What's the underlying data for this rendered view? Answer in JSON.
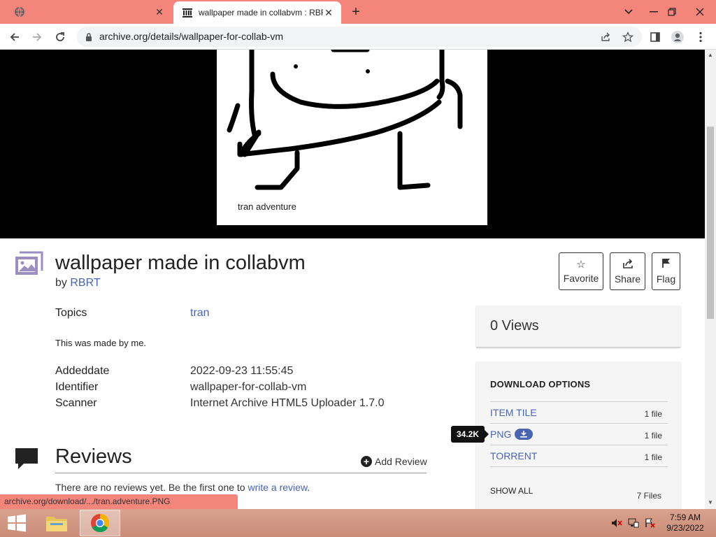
{
  "browser": {
    "tabs": [
      {
        "title": "",
        "active": false
      },
      {
        "title": "wallpaper made in collabvm : RBRT",
        "active": true
      }
    ],
    "new_tab_symbol": "+",
    "address": "archive.org/details/wallpaper-for-collab-vm",
    "status_url": "archive.org/download/.../tran.adventure.PNG"
  },
  "artwork": {
    "caption": "tran adventure"
  },
  "item": {
    "title": "wallpaper made in collabvm",
    "by_prefix": "by",
    "author": "RBRT",
    "actions": {
      "favorite": "Favorite",
      "share": "Share",
      "flag": "Flag"
    },
    "topics_label": "Topics",
    "topics_value": "tran",
    "description": "This was made by me.",
    "metadata": [
      {
        "key": "Addeddate",
        "value": "2022-09-23 11:55:45"
      },
      {
        "key": "Identifier",
        "value": "wallpaper-for-collab-vm"
      },
      {
        "key": "Scanner",
        "value": "Internet Archive HTML5 Uploader 1.7.0"
      }
    ]
  },
  "reviews": {
    "title": "Reviews",
    "add_label": "Add Review",
    "empty_prefix": "There are no reviews yet. Be the first one to",
    "empty_link": "write a review",
    "empty_suffix": "."
  },
  "sidebar": {
    "views": "0 Views",
    "download_heading": "DOWNLOAD OPTIONS",
    "downloads": [
      {
        "name": "ITEM TILE",
        "count": "1 file"
      },
      {
        "name": "PNG",
        "count": "1 file"
      },
      {
        "name": "TORRENT",
        "count": "1 file"
      }
    ],
    "show_all": "SHOW ALL",
    "total_files": "7 Files",
    "tooltip": "34.2K"
  },
  "taskbar": {
    "time": "7:59 AM",
    "date": "9/23/2022"
  },
  "colors": {
    "tab_strip": "#f3857b",
    "link": "#4b64b2",
    "taskbar": "#d09683"
  }
}
